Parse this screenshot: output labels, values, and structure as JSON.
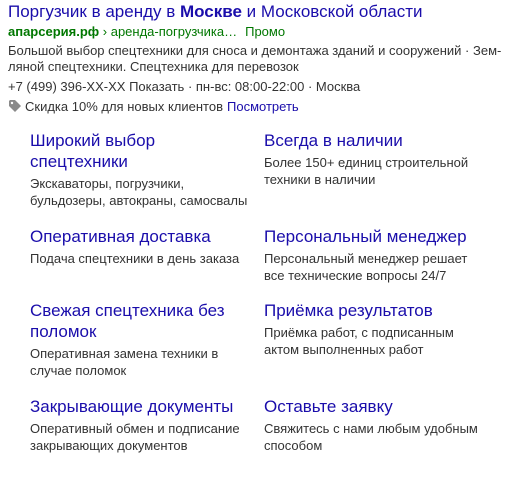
{
  "ad": {
    "title_part1": "Поргузчик в аренду в ",
    "title_bold": "Москве",
    "title_part2": " и Московской области",
    "domain": "апарсерия.рф",
    "path": " › аренда-погрузчика…",
    "promo": "Промо",
    "description": "Большой выбор спецтехники для сноса и демонтажа зданий и сооружений · Зем­ляной спецтехники. Спецтехника для перевозок",
    "phone": "+7 (499) 396-XX-XX",
    "show_label": "Показать",
    "separator1": " · ",
    "hours": "пн-вс: 08:00-22:00",
    "separator2": " · ",
    "city": "Москва",
    "discount_text": "Скидка 10% для новых клиентов",
    "discount_link": "Посмотреть"
  },
  "sitelinks": [
    {
      "title": "Широкий выбор спецтехники",
      "description": "Экскаваторы, погрузчики, бульдозеры, автокраны, самосвалы"
    },
    {
      "title": "Всегда в наличии",
      "description": "Более 150+ единиц строительной техники в наличии"
    },
    {
      "title": "Оперативная доставка",
      "description": "Подача спецтехники в день заказа"
    },
    {
      "title": "Персональный менеджер",
      "description": "Персональный менеджер решает все технические вопросы 24/7"
    },
    {
      "title": "Свежая спецтехника без поломок",
      "description": "Оперативная замена техники в случае поломок"
    },
    {
      "title": "Приёмка результатов",
      "description": "Приёмка работ, с подписанным актом выполненных работ"
    },
    {
      "title": "Закрывающие документы",
      "description": "Оперативный обмен и подписание закрывающих документов"
    },
    {
      "title": "Оставьте заявку",
      "description": "Свяжитесь с нами любым удобным способом"
    }
  ],
  "icons": {
    "discount": "tag-icon",
    "hours": "clock-icon"
  },
  "colors": {
    "link": "#1a0dab",
    "url": "#007700",
    "text": "#333333"
  }
}
